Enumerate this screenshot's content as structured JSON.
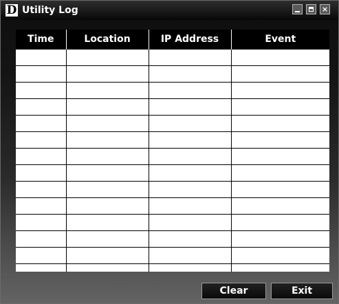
{
  "window": {
    "title": "Utility Log",
    "logo_letter": "D",
    "controls": {
      "minimize_icon": "minimize-icon",
      "maximize_icon": "maximize-icon",
      "close_icon": "close-icon",
      "close_glyph": "×"
    }
  },
  "log_table": {
    "columns": [
      "Time",
      "Location",
      "IP Address",
      "Event"
    ],
    "visible_empty_rows": 14
  },
  "buttons": {
    "clear_label": "Clear",
    "exit_label": "Exit"
  },
  "colors": {
    "header_bg": "#000000",
    "header_text": "#ffffff",
    "grid_line": "#000000",
    "button_border": "#9a9a9a"
  }
}
